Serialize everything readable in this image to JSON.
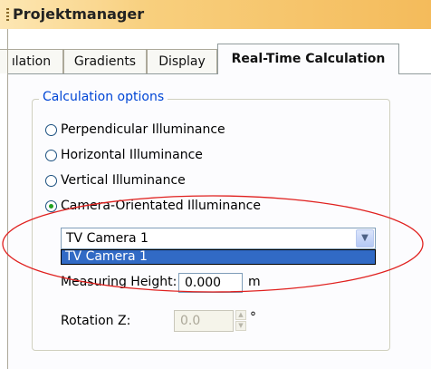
{
  "window": {
    "title": "Projektmanager"
  },
  "tabs": [
    {
      "label": "ılation",
      "active": false
    },
    {
      "label": "Gradients",
      "active": false
    },
    {
      "label": "Display",
      "active": false
    },
    {
      "label": "Real-Time Calculation",
      "active": true
    }
  ],
  "tab_scroll_icon": "left-right-arrows-icon",
  "group": {
    "label": "Calculation options"
  },
  "radios": [
    {
      "label": "Perpendicular Illuminance",
      "checked": false
    },
    {
      "label": "Horizontal Illuminance",
      "checked": false
    },
    {
      "label": "Vertical Illuminance",
      "checked": false
    },
    {
      "label": "Camera-Orientated Illuminance",
      "checked": true
    }
  ],
  "camera_combo": {
    "value": "TV Camera 1",
    "open": true,
    "options": [
      "TV Camera 1"
    ]
  },
  "measuring_height": {
    "label": "Measuring Height:",
    "value": "0.000",
    "unit": "m"
  },
  "rotation_z": {
    "label": "Rotation Z:",
    "value": "0.0",
    "unit": "°",
    "enabled": false
  },
  "colors": {
    "selection": "#316ac5",
    "group_label": "#0046d5",
    "highlight_ellipse": "#e0201e"
  }
}
